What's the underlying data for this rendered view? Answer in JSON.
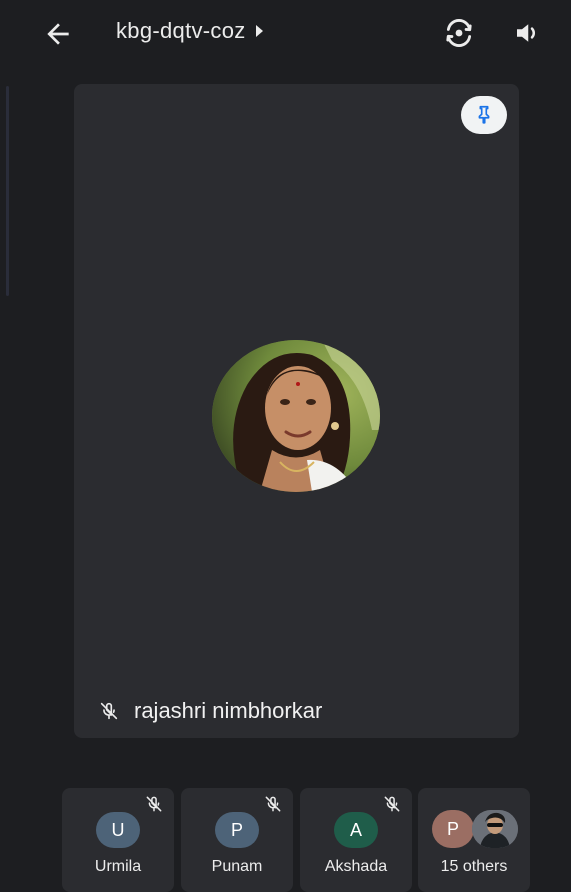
{
  "header": {
    "meeting_code": "kbg-dqtv-coz"
  },
  "main_tile": {
    "participant_name": "rajashri nimbhorkar",
    "muted": true,
    "pinned": true
  },
  "participants": [
    {
      "initial": "U",
      "name": "Urmila",
      "muted": true,
      "color": "#4d6378"
    },
    {
      "initial": "P",
      "name": "Punam",
      "muted": true,
      "color": "#4d6378"
    },
    {
      "initial": "A",
      "name": "Akshada",
      "muted": true,
      "color": "#1f5d4a"
    }
  ],
  "others": {
    "initial": "P",
    "label": "15 others",
    "color": "#9b6e63"
  },
  "icons": {
    "back": "arrow-left-icon",
    "caret": "caret-right-icon",
    "switch_camera": "switch-camera-icon",
    "speaker": "speaker-icon",
    "pin": "pin-icon",
    "mic_off": "mic-off-icon"
  },
  "colors": {
    "background": "#1d1e21",
    "tile": "#2b2c30",
    "pin_accent": "#1a73e8"
  }
}
